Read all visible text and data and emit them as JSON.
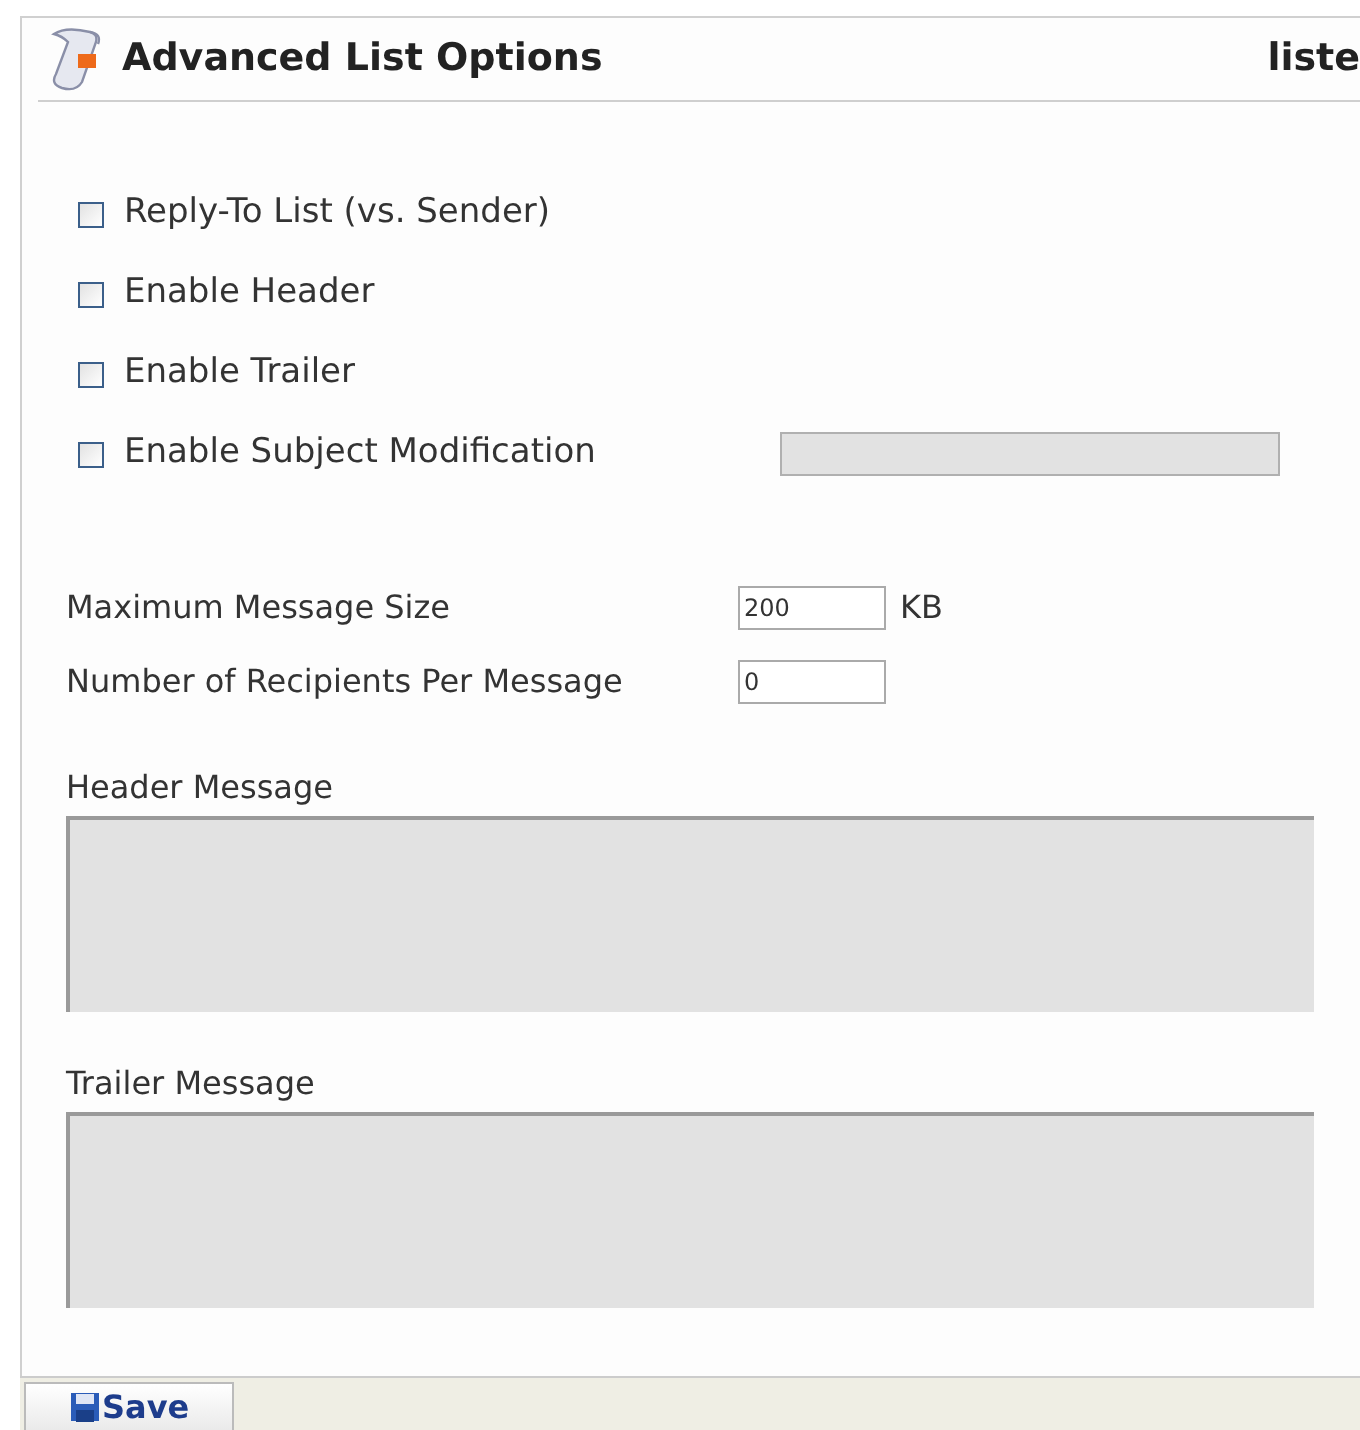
{
  "header": {
    "title": "Advanced List Options",
    "right_text": "liste"
  },
  "options": [
    {
      "label": "Reply-To List (vs. Sender)",
      "checked": false
    },
    {
      "label": "Enable Header",
      "checked": false
    },
    {
      "label": "Enable Trailer",
      "checked": false
    },
    {
      "label": "Enable Subject Modification",
      "checked": false
    }
  ],
  "subject_field": {
    "disabled": true
  },
  "fields": [
    {
      "label": "Maximum Message Size",
      "value": "200",
      "unit": "KB"
    },
    {
      "label": "Number of Recipients Per Message",
      "value": "0"
    }
  ],
  "messages": [
    {
      "label": "Header Message",
      "disabled": true
    },
    {
      "label": "Trailer Message",
      "disabled": true
    }
  ],
  "save_button": {
    "label": "Save"
  }
}
